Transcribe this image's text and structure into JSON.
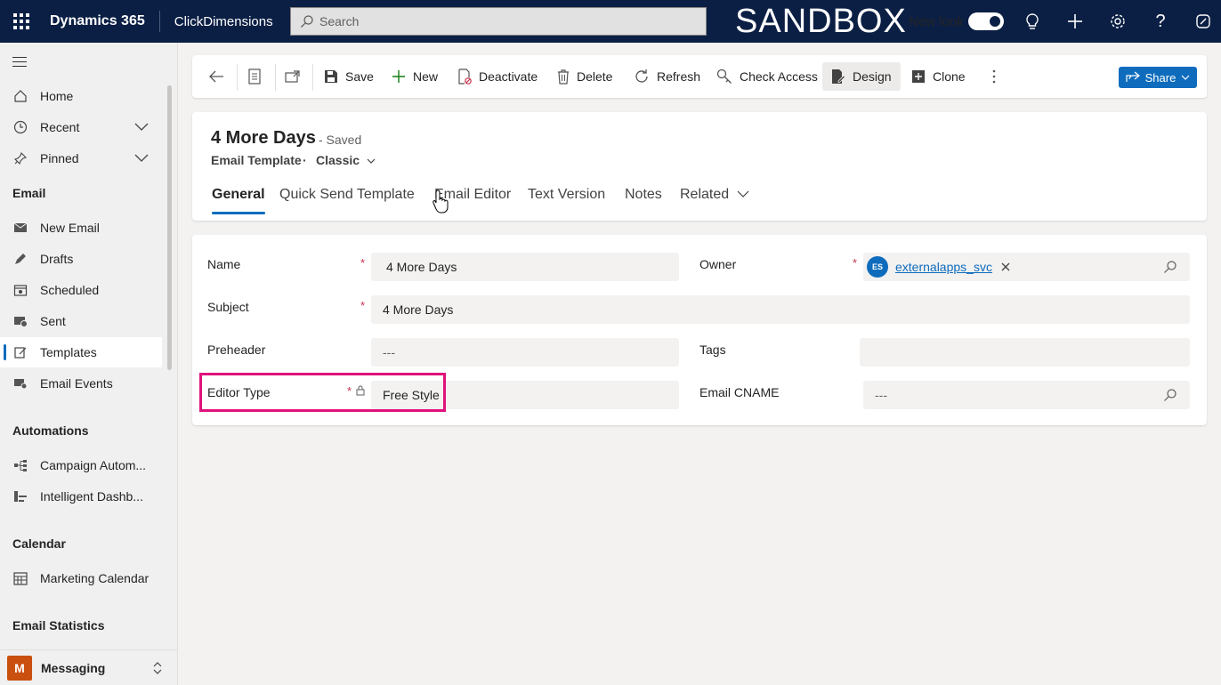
{
  "topbar": {
    "app_title": "Dynamics 365",
    "app_sub": "ClickDimensions",
    "search_placeholder": "Search",
    "environment_banner": "SANDBOX",
    "new_look_label": "New look",
    "new_look_on": true
  },
  "sidebar": {
    "items_top": [
      {
        "label": "Home",
        "icon": "home-icon"
      },
      {
        "label": "Recent",
        "icon": "clock-icon"
      },
      {
        "label": "Pinned",
        "icon": "pin-icon"
      }
    ],
    "sections": [
      {
        "title": "Email",
        "items": [
          {
            "label": "New Email",
            "icon": "mail-icon"
          },
          {
            "label": "Drafts",
            "icon": "draft-icon"
          },
          {
            "label": "Scheduled",
            "icon": "calendar-icon"
          },
          {
            "label": "Sent",
            "icon": "sent-icon"
          },
          {
            "label": "Templates",
            "icon": "template-icon",
            "active": true
          },
          {
            "label": "Email Events",
            "icon": "events-icon"
          }
        ]
      },
      {
        "title": "Automations",
        "items": [
          {
            "label": "Campaign Autom...",
            "icon": "flow-icon"
          },
          {
            "label": "Intelligent Dashb...",
            "icon": "dashboard-icon"
          }
        ]
      },
      {
        "title": "Calendar",
        "items": [
          {
            "label": "Marketing Calendar",
            "icon": "calendar-grid-icon"
          }
        ]
      },
      {
        "title": "Email Statistics",
        "items": []
      }
    ],
    "area": {
      "badge": "M",
      "name": "Messaging"
    }
  },
  "commandbar": {
    "save": "Save",
    "new": "New",
    "deactivate": "Deactivate",
    "delete": "Delete",
    "refresh": "Refresh",
    "check_access": "Check Access",
    "design": "Design",
    "clone": "Clone",
    "share": "Share"
  },
  "record": {
    "title": "4 More Days",
    "status": "- Saved",
    "entity": "Email Template",
    "dot": "·",
    "form": "Classic"
  },
  "tabs": [
    "General",
    "Quick Send Template",
    "Email Editor",
    "Text Version",
    "Notes",
    "Related"
  ],
  "form": {
    "name": {
      "label": "Name",
      "value": "4 More Days"
    },
    "subject": {
      "label": "Subject",
      "value": "4 More Days"
    },
    "preheader": {
      "label": "Preheader",
      "value": "---"
    },
    "editor_type": {
      "label": "Editor Type",
      "value": "Free Style"
    },
    "owner": {
      "label": "Owner",
      "initials": "ES",
      "value": "externalapps_svc"
    },
    "tags": {
      "label": "Tags",
      "value": ""
    },
    "email_cname": {
      "label": "Email CNAME",
      "value": "---"
    },
    "required_mark": "*"
  }
}
